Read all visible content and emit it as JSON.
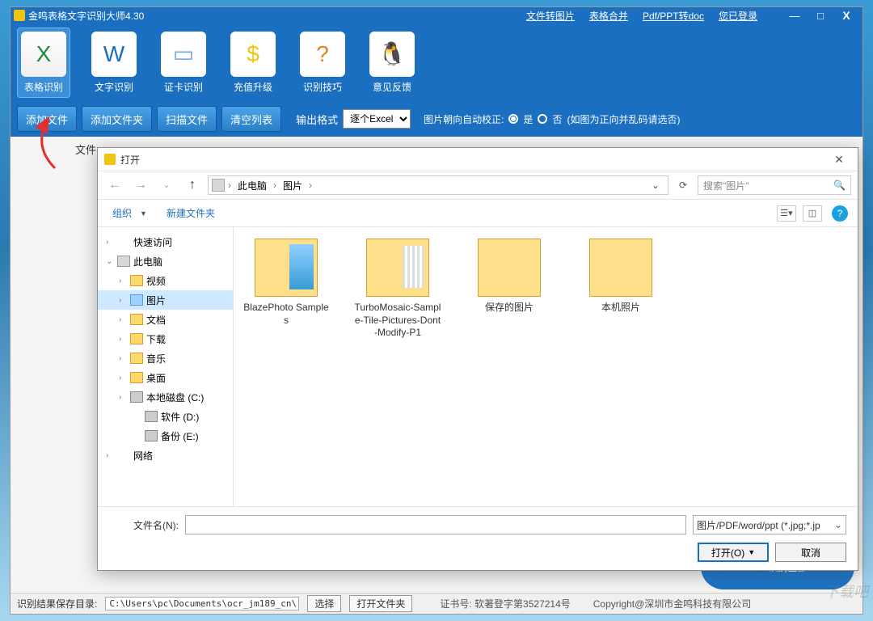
{
  "titlebar": {
    "title": "金鸣表格文字识别大师4.30",
    "links": [
      "文件转图片",
      "表格合并",
      "Pdf/PPT转doc",
      "您已登录"
    ],
    "min": "—",
    "max": "□",
    "close": "X"
  },
  "toolbar": [
    {
      "label": "表格识别",
      "icon": "X",
      "cls": "excel",
      "active": true
    },
    {
      "label": "文字识别",
      "icon": "W",
      "cls": "text"
    },
    {
      "label": "证卡识别",
      "icon": "▭",
      "cls": "card"
    },
    {
      "label": "充值升级",
      "icon": "$",
      "cls": "coin"
    },
    {
      "label": "识别技巧",
      "icon": "?",
      "cls": "bulb"
    },
    {
      "label": "意见反馈",
      "icon": "🐧",
      "cls": "qq"
    }
  ],
  "optionbar": {
    "buttons": [
      "添加文件",
      "添加文件夹",
      "扫描文件",
      "清空列表"
    ],
    "output_label": "输出格式",
    "output_value": "逐个Excel",
    "orient_label": "图片朝向自动校正:",
    "yes": "是",
    "no": "否",
    "note": "(如图为正向并乱码请选否)"
  },
  "content": {
    "file_label": "文件"
  },
  "dialog": {
    "title": "打开",
    "crumb": [
      "此电脑",
      "图片"
    ],
    "search_placeholder": "搜索\"图片\"",
    "toolbar": {
      "organize": "组织",
      "newfolder": "新建文件夹"
    },
    "tree": [
      {
        "label": "快速访问",
        "depth": 0,
        "exp": "›",
        "icn": "star"
      },
      {
        "label": "此电脑",
        "depth": 0,
        "exp": "⌄",
        "icn": "pc"
      },
      {
        "label": "视频",
        "depth": 1,
        "exp": "›",
        "icn": "fld"
      },
      {
        "label": "图片",
        "depth": 1,
        "exp": "›",
        "icn": "pic",
        "sel": true
      },
      {
        "label": "文档",
        "depth": 1,
        "exp": "›",
        "icn": "fld"
      },
      {
        "label": "下载",
        "depth": 1,
        "exp": "›",
        "icn": "fld"
      },
      {
        "label": "音乐",
        "depth": 1,
        "exp": "›",
        "icn": "fld"
      },
      {
        "label": "桌面",
        "depth": 1,
        "exp": "›",
        "icn": "fld"
      },
      {
        "label": "本地磁盘 (C:)",
        "depth": 1,
        "exp": "›",
        "icn": "disk"
      },
      {
        "label": "软件 (D:)",
        "depth": 2,
        "exp": "",
        "icn": "disk"
      },
      {
        "label": "备份 (E:)",
        "depth": 2,
        "exp": "",
        "icn": "disk"
      },
      {
        "label": "网络",
        "depth": 0,
        "exp": "›",
        "icn": "net"
      }
    ],
    "files": [
      {
        "name": "BlazePhoto Samples",
        "thumb": "photo"
      },
      {
        "name": "TurboMosaic-Sample-Tile-Pictures-Dont-Modify-P1",
        "thumb": "mosaic"
      },
      {
        "name": "保存的图片",
        "thumb": ""
      },
      {
        "name": "本机照片",
        "thumb": ""
      }
    ],
    "filename_label": "文件名(N):",
    "filter": "图片/PDF/word/ppt (*.jpg;*.jp",
    "open": "打开(O)",
    "cancel": "取消"
  },
  "statusbar": {
    "label": "识别结果保存目录:",
    "path": "C:\\Users\\pc\\Documents\\ocr_jm189_cn\\",
    "choose": "选择",
    "openfolder": "打开文件夹",
    "cert": "证书号: 软著登字第3527214号",
    "copy": "Copyright@深圳市金鸣科技有限公司"
  },
  "bigbtn": "识别全部",
  "watermark": "下载吧"
}
